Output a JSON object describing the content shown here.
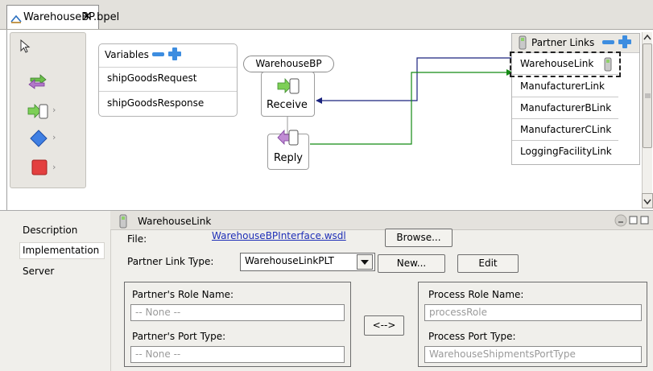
{
  "tab": {
    "title": "WarehouseBP.bpel",
    "close": "✕"
  },
  "palette": {
    "arrow": "›"
  },
  "variables": {
    "title": "Variables",
    "items": [
      "shipGoodsRequest",
      "shipGoodsResponse"
    ]
  },
  "process": {
    "name": "WarehouseBP"
  },
  "activities": {
    "receive": "Receive",
    "reply": "Reply"
  },
  "partner_links": {
    "title": "Partner Links",
    "items": [
      "WarehouseLink",
      "ManufacturerLink",
      "ManufacturerBLink",
      "ManufacturerCLink",
      "LoggingFacilityLink"
    ]
  },
  "properties": {
    "title": "WarehouseLink",
    "tabs": [
      "Description",
      "Implementation",
      "Server"
    ],
    "file_label": "File:",
    "file_value": "WarehouseBPInterface.wsdl",
    "browse": "Browse...",
    "plt_label": "Partner Link Type:",
    "plt_value": "WarehouseLinkPLT",
    "new": "New...",
    "edit": "Edit",
    "swap": "<-->",
    "partner_role_label": "Partner's Role Name:",
    "partner_role_value": "-- None --",
    "partner_port_label": "Partner's Port Type:",
    "partner_port_value": "-- None --",
    "process_role_label": "Process Role Name:",
    "process_role_value": "processRole",
    "process_port_label": "Process Port Type:",
    "process_port_value": "WarehouseShipmentsPortType"
  },
  "colors": {
    "blue_connector": "#1a237e",
    "green_connector": "#138a13",
    "link": "#1f2fb7"
  }
}
